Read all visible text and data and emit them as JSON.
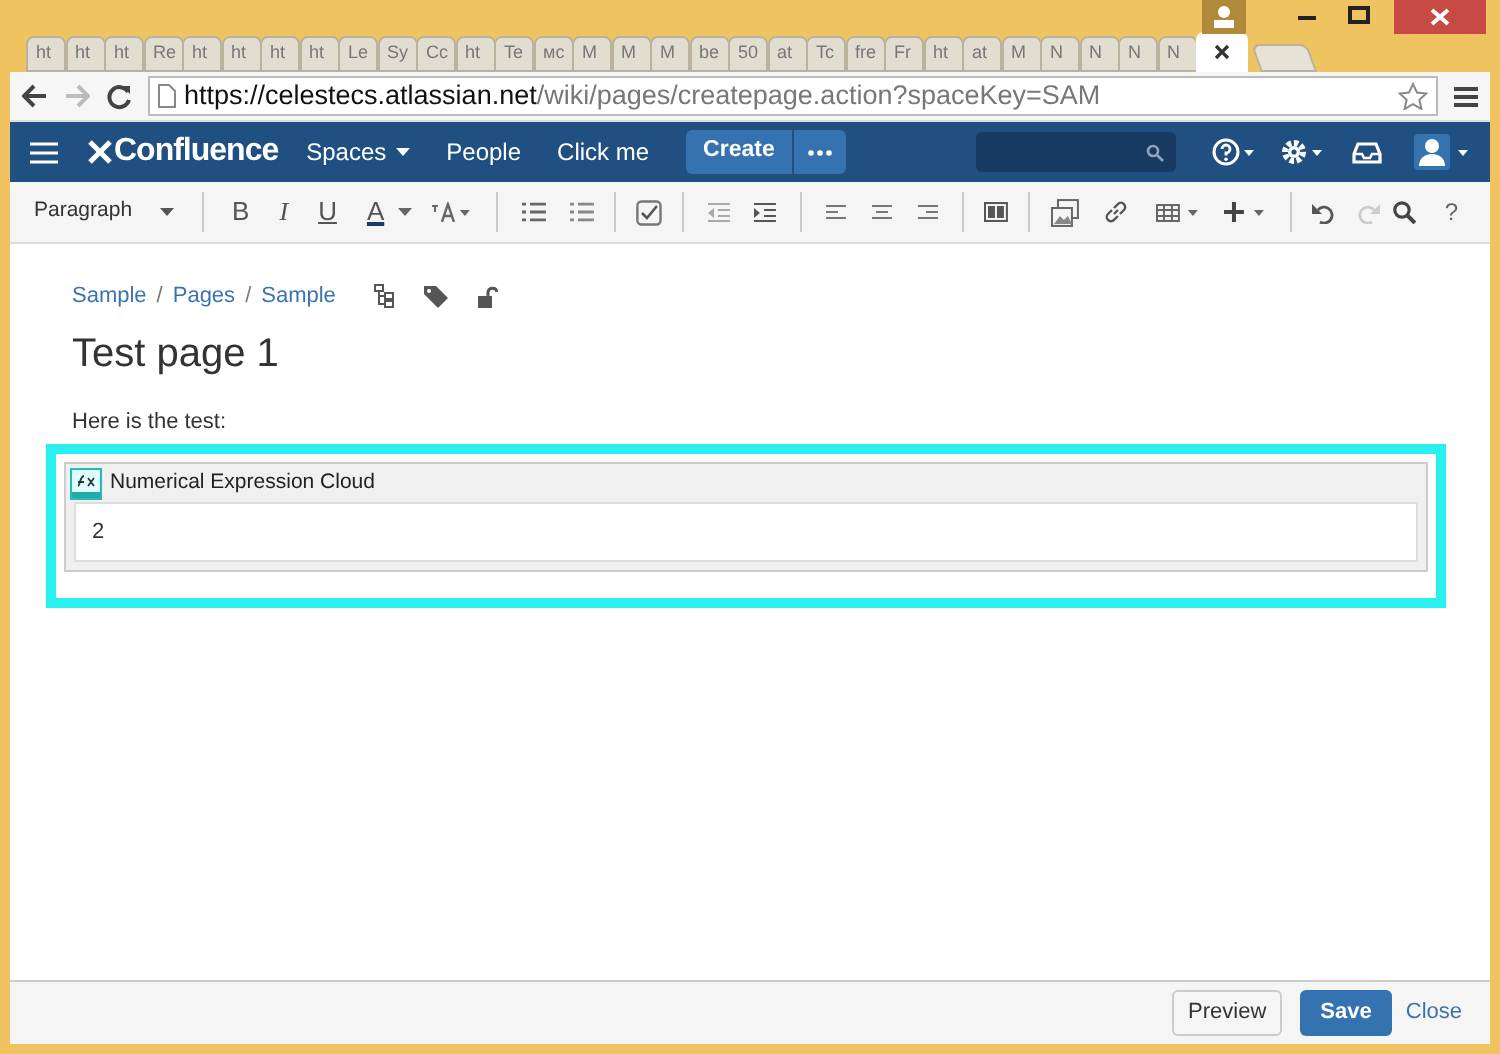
{
  "browser": {
    "tabs": [
      {
        "label": "ht",
        "selected": false
      },
      {
        "label": "ht",
        "selected": false
      },
      {
        "label": "ht",
        "selected": false
      },
      {
        "label": "Re",
        "selected": false
      },
      {
        "label": "ht",
        "selected": false
      },
      {
        "label": "ht",
        "selected": false
      },
      {
        "label": "ht",
        "selected": false
      },
      {
        "label": "ht",
        "selected": false
      },
      {
        "label": "Le",
        "selected": false
      },
      {
        "label": "Sy",
        "selected": false
      },
      {
        "label": "Cc",
        "selected": false
      },
      {
        "label": "ht",
        "selected": false
      },
      {
        "label": "Te",
        "selected": false
      },
      {
        "label": "мс",
        "selected": false
      },
      {
        "label": "M",
        "selected": false
      },
      {
        "label": "M",
        "selected": false
      },
      {
        "label": "M",
        "selected": false
      },
      {
        "label": "be",
        "selected": false
      },
      {
        "label": "50",
        "selected": false
      },
      {
        "label": "at",
        "selected": false
      },
      {
        "label": "Tc",
        "selected": false
      },
      {
        "label": "fre",
        "selected": false
      },
      {
        "label": "Fr",
        "selected": false
      },
      {
        "label": "ht",
        "selected": false
      },
      {
        "label": "at",
        "selected": false
      },
      {
        "label": "M",
        "selected": false
      },
      {
        "label": "N",
        "selected": false
      },
      {
        "label": "N",
        "selected": false
      },
      {
        "label": "N",
        "selected": false
      },
      {
        "label": "N",
        "selected": false
      },
      {
        "selected": true
      }
    ],
    "url": {
      "host": "https://celestecs.atlassian.net",
      "path": "/wiki/pages/createpage.action?spaceKey=SAM"
    }
  },
  "nav": {
    "logo": "Confluence",
    "items": [
      {
        "label": "Spaces",
        "dropdown": true
      },
      {
        "label": "People",
        "dropdown": false
      },
      {
        "label": "Click me",
        "dropdown": false
      }
    ],
    "create": "Create"
  },
  "editor_toolbar": {
    "format": "Paragraph",
    "text_buttons": [
      {
        "label": "B",
        "kind": "bold"
      },
      {
        "label": "I",
        "kind": "italic"
      },
      {
        "label": "U",
        "kind": "underline"
      },
      {
        "label": "A",
        "kind": "color"
      }
    ],
    "help": "?"
  },
  "breadcrumbs": [
    "Sample",
    "Pages",
    "Sample"
  ],
  "breadcrumb_separator": "/",
  "title": "Test page 1",
  "body": "Here is the test:",
  "macro": {
    "name": "Numerical Expression Cloud",
    "value": "2",
    "selected": true
  },
  "footer": {
    "preview": "Preview",
    "save": "Save",
    "close": "Close"
  }
}
